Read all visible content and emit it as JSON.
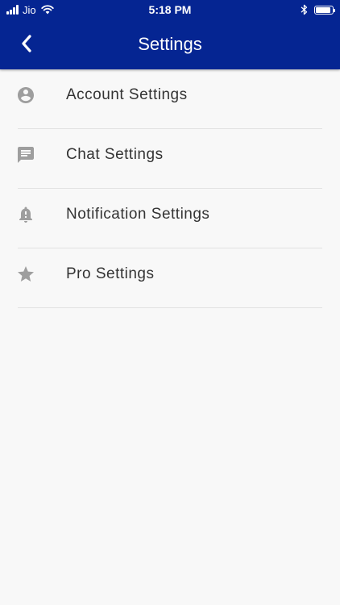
{
  "status_bar": {
    "carrier": "Jio",
    "time": "5:18 PM",
    "battery_level": 0.9
  },
  "header": {
    "title": "Settings"
  },
  "settings_items": [
    {
      "label": "Account Settings",
      "icon": "account-circle-icon"
    },
    {
      "label": "Chat Settings",
      "icon": "chat-icon"
    },
    {
      "label": "Notification Settings",
      "icon": "bell-icon"
    },
    {
      "label": "Pro Settings",
      "icon": "star-icon"
    }
  ],
  "colors": {
    "header_bg": "#052592",
    "icon": "#9e9e9e",
    "text": "#333333",
    "background": "#f8f8f8",
    "divider": "#e2e2e2"
  }
}
